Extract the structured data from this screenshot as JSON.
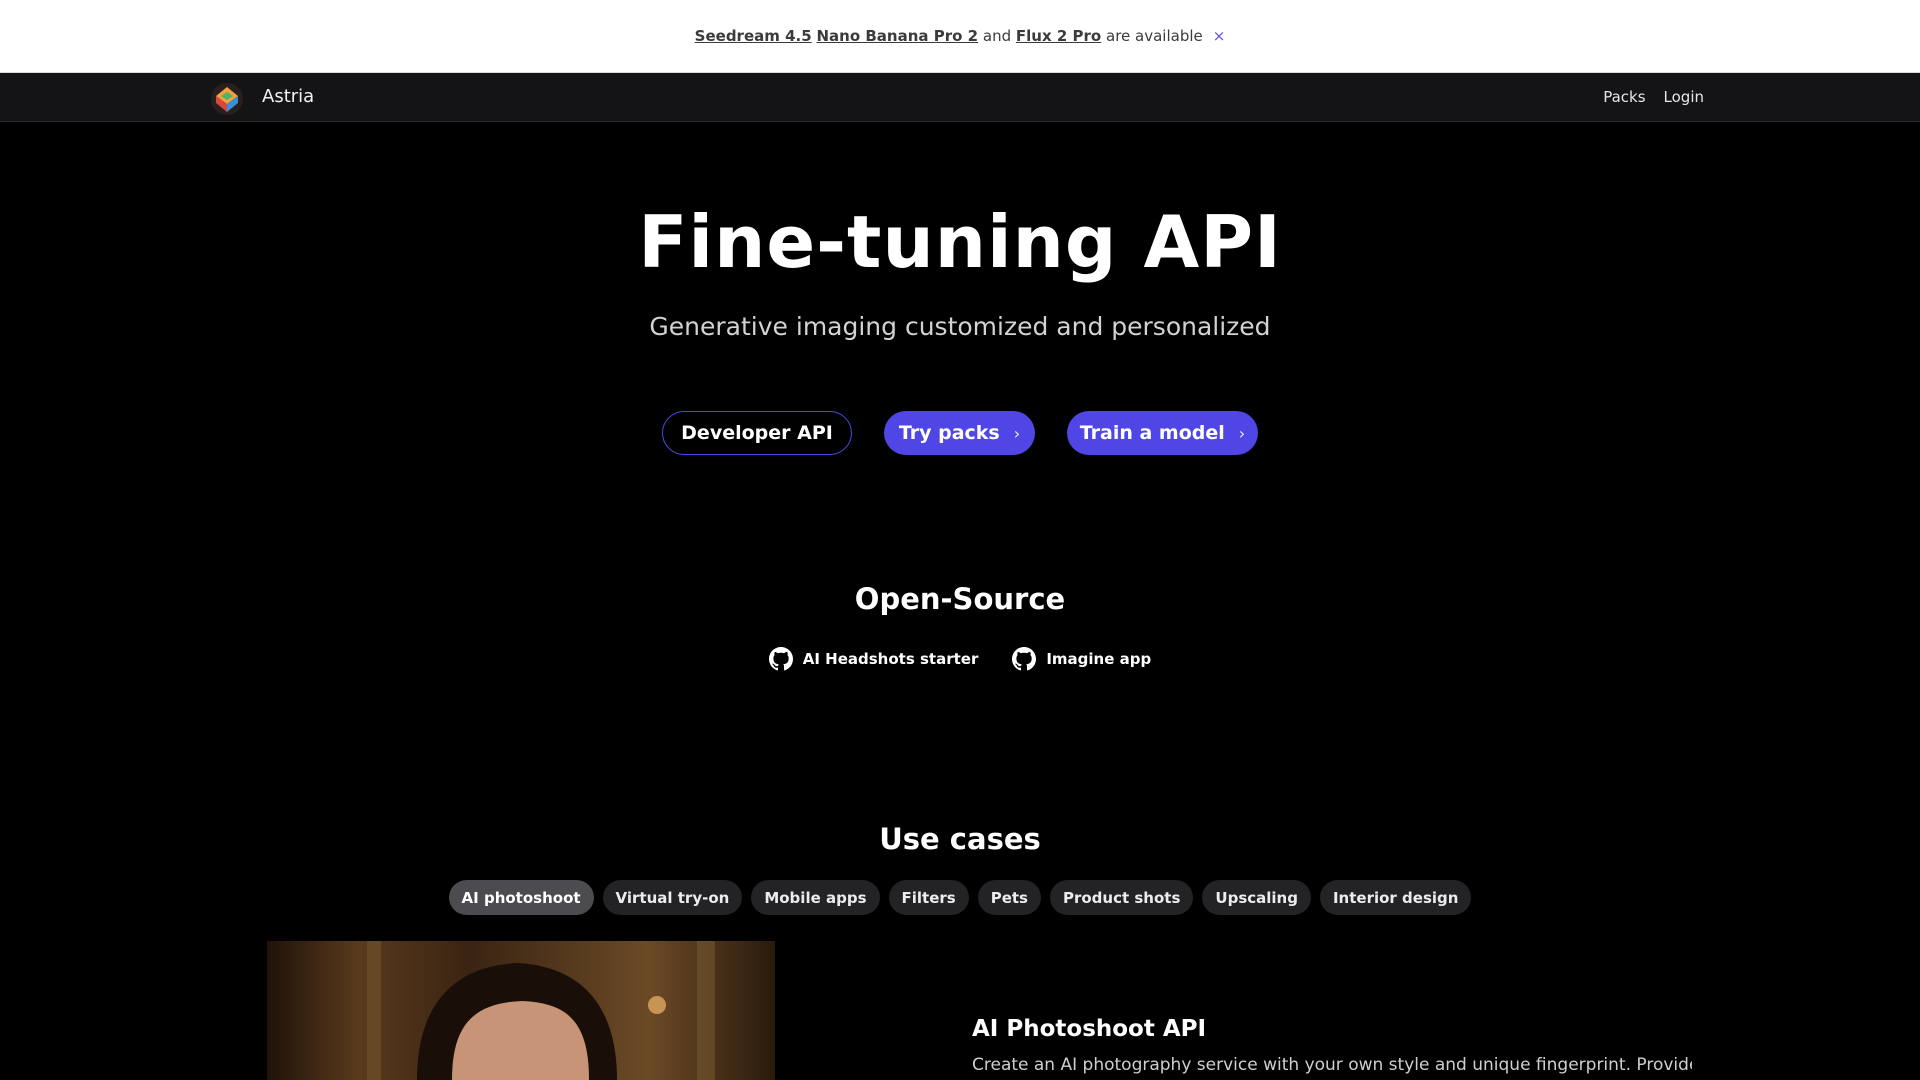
{
  "banner": {
    "link1": "Seedream 4.5",
    "link2": "Nano Banana Pro 2",
    "and_text": "and",
    "link3": "Flux 2 Pro",
    "suffix": "are available",
    "close_glyph": "×"
  },
  "nav": {
    "brand": "Astria",
    "logo_icon": "astria-logo-icon",
    "links": [
      "Packs",
      "Login"
    ]
  },
  "hero": {
    "title": "Fine-tuning API",
    "subtitle": "Generative imaging customized and personalized",
    "buttons": {
      "developer_api": "Developer API",
      "try_packs": "Try packs",
      "train_model": "Train a model"
    },
    "chevron_glyph": "›"
  },
  "open_source": {
    "title": "Open-Source",
    "repos": [
      "AI Headshots starter",
      "Imagine app"
    ],
    "repo_icon": "github-icon"
  },
  "use_cases": {
    "title": "Use cases",
    "tabs": [
      "AI photoshoot",
      "Virtual try-on",
      "Mobile apps",
      "Filters",
      "Pets",
      "Product shots",
      "Upscaling",
      "Interior design"
    ],
    "active_tab": "AI photoshoot",
    "detail": {
      "heading": "AI Photoshoot API",
      "description": "Create an AI photography service with your own style and unique fingerprint. Provide"
    }
  },
  "colors": {
    "accent": "#4f46e5",
    "background": "#000000",
    "nav_background": "#141416"
  }
}
